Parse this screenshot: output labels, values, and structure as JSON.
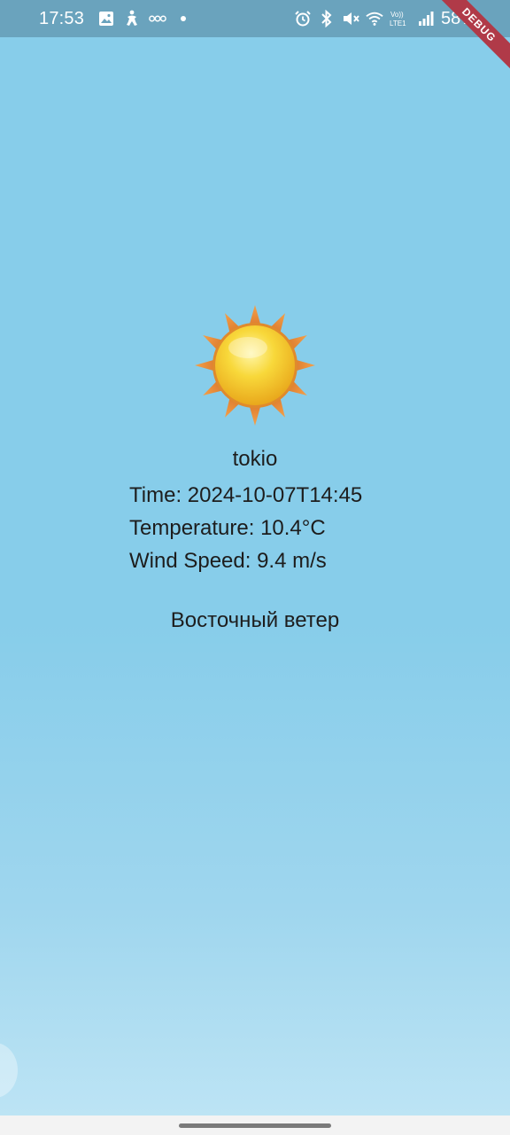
{
  "status_bar": {
    "time": "17:53",
    "left_icons": [
      "image-icon",
      "accessibility-icon",
      "voicemail-icon",
      "dot-icon"
    ],
    "right_icons": [
      "alarm-icon",
      "bluetooth-icon",
      "mute-icon",
      "wifi-icon",
      "volte-icon",
      "signal-icon"
    ],
    "volte_text": "Vo)) LTE1",
    "battery": "58%"
  },
  "debug_banner": {
    "label": "DEBUG"
  },
  "weather": {
    "icon": "sun-icon",
    "city": "tokio",
    "time_line": "Time: 2024-10-07T14:45",
    "temperature_line": "Temperature: 10.4°C",
    "wind_speed_line": "Wind Speed: 9.4 m/s",
    "wind_direction": "Восточный ветер"
  },
  "colors": {
    "background_top": "#87cdea",
    "background_bottom": "#bfe5f5",
    "status_bar": "#6aa3bd",
    "text": "#1d1d1d",
    "debug": "#b03a48"
  }
}
